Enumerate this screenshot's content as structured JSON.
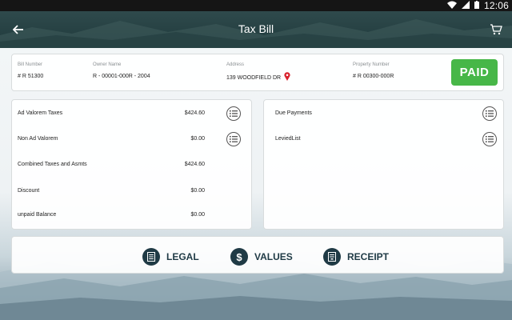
{
  "status_bar": {
    "time": "12:06"
  },
  "header": {
    "title": "Tax Bill"
  },
  "info": {
    "bill_number_label": "Bill Number",
    "bill_number": "# R 51300",
    "owner_name_label": "Owner Name",
    "owner_name": "R - 00001-000R - 2004",
    "address_label": "Address",
    "address": "139 WOODFIELD DR",
    "property_number_label": "Property Number",
    "property_number": "# R 00300-000R",
    "status": "PAID",
    "status_color": "#47b748"
  },
  "taxes": {
    "rows": [
      {
        "label": "Ad Valorem Taxes",
        "amount": "$424.60"
      },
      {
        "label": "Non Ad Valorem",
        "amount": "$0.00"
      },
      {
        "label": "Combined Taxes and Asmts",
        "amount": "$424.60"
      },
      {
        "label": "Discount",
        "amount": "$0.00"
      },
      {
        "label": "unpaid Balance",
        "amount": "$0.00"
      }
    ]
  },
  "payments": {
    "items": [
      {
        "label": "Due Payments"
      },
      {
        "label": "LeviedList"
      }
    ]
  },
  "actions": {
    "legal": "LEGAL",
    "values": "VALUES",
    "values_symbol": "$",
    "receipt": "RECEIPT"
  },
  "colors": {
    "header_bg": "#2f4a4c",
    "accent": "#1f3a45",
    "paid": "#47b748"
  }
}
